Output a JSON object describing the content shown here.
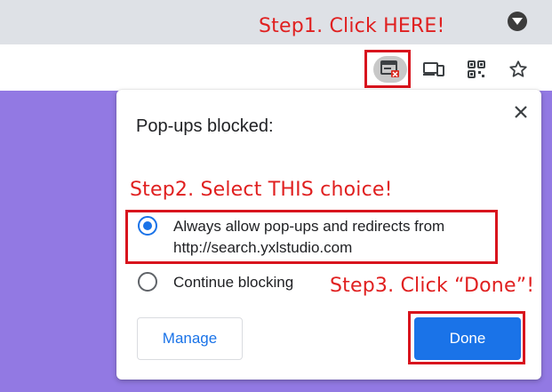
{
  "annotations": {
    "step1": "Step1. Click HERE!",
    "step2": "Step2. Select THIS choice!",
    "step3": "Step3. Click “Done”!",
    "highlight_color": "#d8141d"
  },
  "toolbar": {
    "icons": [
      "popup-blocked-icon",
      "cast-devices-icon",
      "qr-code-icon",
      "bookmark-star-icon"
    ]
  },
  "dialog": {
    "title": "Pop-ups blocked:",
    "options": [
      {
        "line1": "Always allow pop-ups and redirects from",
        "line2": "http://search.yxlstudio.com",
        "selected": true
      },
      {
        "line1": "Continue blocking",
        "selected": false
      }
    ],
    "manage_label": "Manage",
    "done_label": "Done"
  },
  "colors": {
    "accent": "#1a73e8",
    "page_background": "#9279e3",
    "annotation": "#e02020"
  }
}
